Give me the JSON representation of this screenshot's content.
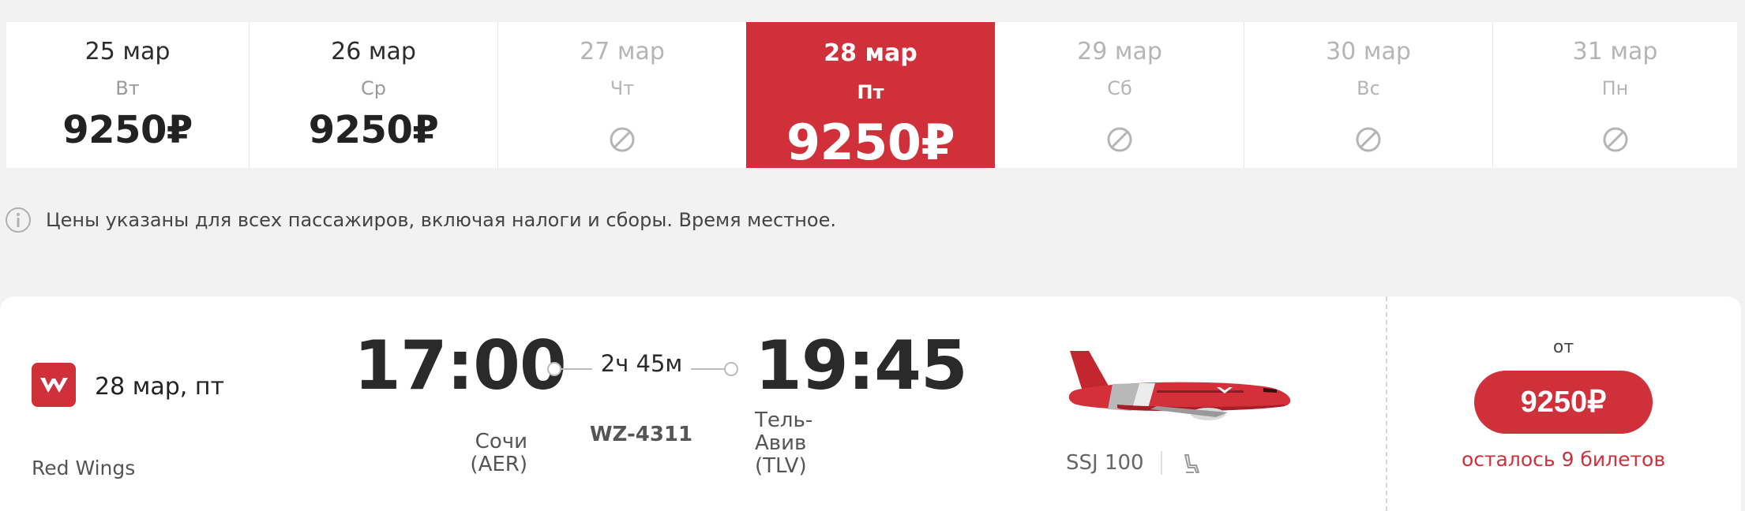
{
  "dates": [
    {
      "date": "25 мар",
      "weekday": "Вт",
      "price": "9250₽",
      "available": true,
      "active": false
    },
    {
      "date": "26 мар",
      "weekday": "Ср",
      "price": "9250₽",
      "available": true,
      "active": false
    },
    {
      "date": "27 мар",
      "weekday": "Чт",
      "price": "",
      "available": false,
      "active": false
    },
    {
      "date": "28 мар",
      "weekday": "Пт",
      "price": "9250₽",
      "available": true,
      "active": true
    },
    {
      "date": "29 мар",
      "weekday": "Сб",
      "price": "",
      "available": false,
      "active": false
    },
    {
      "date": "30 мар",
      "weekday": "Вс",
      "price": "",
      "available": false,
      "active": false
    },
    {
      "date": "31 мар",
      "weekday": "Пн",
      "price": "",
      "available": false,
      "active": false
    }
  ],
  "info": {
    "text": "Цены указаны для всех пассажиров, включая налоги и сборы. Время местное."
  },
  "flight": {
    "date": "28 мар, пт",
    "airline": "Red Wings",
    "departure_time": "17:00",
    "arrival_time": "19:45",
    "duration": "2ч 45м",
    "flight_number": "WZ-4311",
    "departure_city": "Сочи",
    "departure_code": "(AER)",
    "arrival_city_line1": "Тель-",
    "arrival_city_line2": "Авив",
    "arrival_code": "(TLV)",
    "aircraft": "SSJ 100",
    "price_prefix": "от",
    "price": "9250₽",
    "tickets_left": "осталось 9 билетов"
  },
  "colors": {
    "accent": "#d0303a",
    "background": "#f2f2f2"
  },
  "icons": {
    "unavailable": "no-flights-icon",
    "info": "info-icon",
    "seat": "seat-icon",
    "airline_logo": "red-wings-logo"
  }
}
